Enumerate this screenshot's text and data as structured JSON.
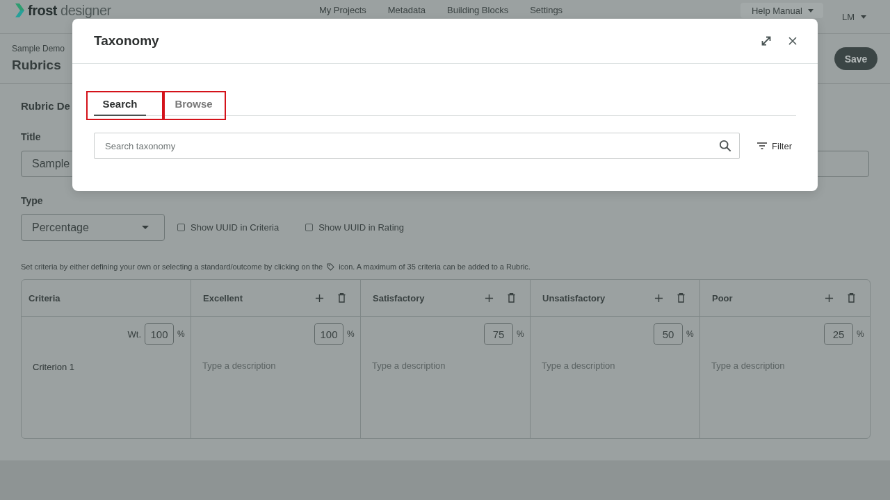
{
  "header": {
    "logo": "**frost** designer",
    "nav": [
      "My Projects",
      "Metadata",
      "Building Blocks",
      "Settings"
    ],
    "help_menu": "Help Manual",
    "user_menu": "LM"
  },
  "page_header": {
    "breadcrumb": "Sample Demo",
    "title": "Rubrics",
    "save_button": "Save"
  },
  "form": {
    "section_title": "Rubric De",
    "title_label": "Title",
    "title_value": "Sample",
    "type_label": "Type",
    "type_value": "Percentage",
    "options": [
      {
        "label": "Show UUID in Criteria",
        "checked": false
      },
      {
        "label": "Show UUID in Rating",
        "checked": false
      }
    ],
    "helper_text": {
      "before_icon": "Set criteria by either defining your own or selecting a standard/outcome by clicking on the",
      "after_icon": "icon. A maximum of 35 criteria can be added to a Rubric."
    }
  },
  "rubric_table": {
    "criteria_heading": "Criteria",
    "levels": [
      "Excellent",
      "Satisfactory",
      "Unsatisfactory",
      "Poor"
    ],
    "criteria": [
      {
        "name": "Criterion 1",
        "weight_label": "Wt.",
        "weight": "100",
        "weight_unit": "%",
        "cells": [
          {
            "score": "100",
            "unit": "%",
            "placeholder": "Type a description"
          },
          {
            "score": "75",
            "unit": "%",
            "placeholder": "Type a description"
          },
          {
            "score": "50",
            "unit": "%",
            "placeholder": "Type a description"
          },
          {
            "score": "25",
            "unit": "%",
            "placeholder": "Type a description"
          }
        ]
      }
    ]
  },
  "modal": {
    "title": "Taxonomy",
    "tabs": [
      {
        "label": "Search",
        "selected": true,
        "highlighted": true
      },
      {
        "label": "Browse",
        "selected": false,
        "highlighted": true
      }
    ],
    "search": {
      "placeholder": "Search taxonomy"
    },
    "filter_button": "Filter"
  }
}
